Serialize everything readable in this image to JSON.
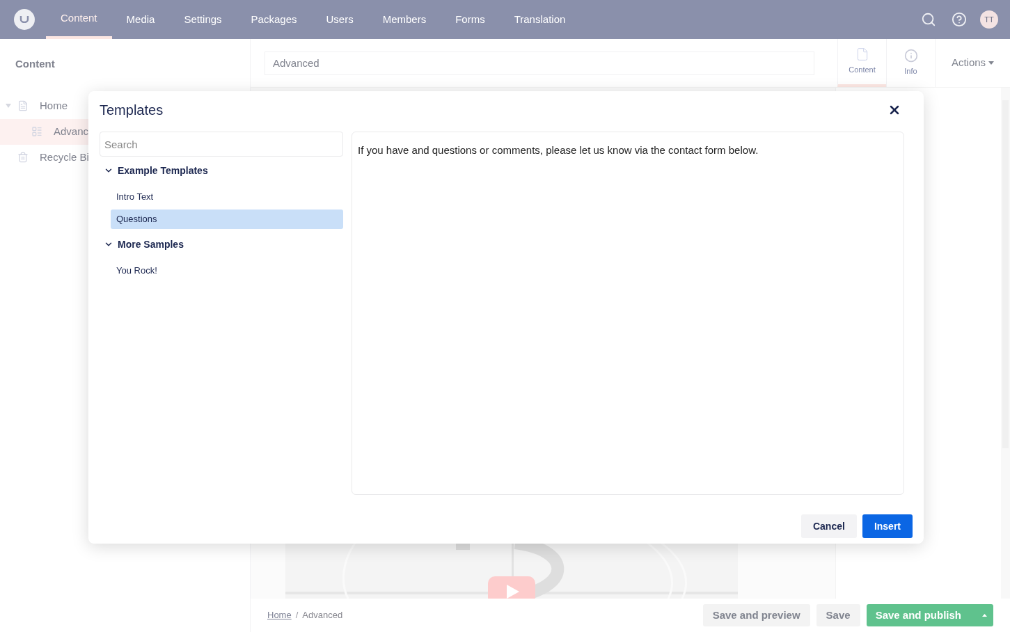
{
  "top_nav": {
    "tabs": [
      {
        "label": "Content",
        "selected": true
      },
      {
        "label": "Media",
        "selected": false
      },
      {
        "label": "Settings",
        "selected": false
      },
      {
        "label": "Packages",
        "selected": false
      },
      {
        "label": "Users",
        "selected": false
      },
      {
        "label": "Members",
        "selected": false
      },
      {
        "label": "Forms",
        "selected": false
      },
      {
        "label": "Translation",
        "selected": false
      }
    ],
    "avatar": "TT"
  },
  "sidebar": {
    "title": "Content",
    "tree": [
      {
        "label": "Home",
        "kind": "page",
        "expanded": true,
        "selected": false,
        "children": [
          {
            "label": "Advanc",
            "kind": "form",
            "selected": true
          }
        ]
      },
      {
        "label": "Recycle Bi",
        "kind": "bin",
        "selected": false
      }
    ]
  },
  "editor": {
    "name_value": "Advanced",
    "apps": [
      {
        "label": "Content",
        "kind": "document",
        "selected": true
      },
      {
        "label": "Info",
        "kind": "info",
        "selected": false
      }
    ],
    "actions": "Actions"
  },
  "footer": {
    "breadcrumb": [
      "Home",
      "Advanced"
    ],
    "breadcrumb_separator": "/",
    "buttons": [
      {
        "label": "Save and preview",
        "kind": "secondary"
      },
      {
        "label": "Save",
        "kind": "secondary"
      },
      {
        "label": "Save and publish",
        "kind": "primary"
      }
    ]
  },
  "dialog": {
    "title": "Templates",
    "search_placeholder": "Search",
    "groups": [
      {
        "label": "Example Templates",
        "expanded": true,
        "items": [
          {
            "label": "Intro Text",
            "selected": false
          },
          {
            "label": "Questions",
            "selected": true
          }
        ]
      },
      {
        "label": "More Samples",
        "expanded": true,
        "items": [
          {
            "label": "You Rock!",
            "selected": false
          }
        ]
      }
    ],
    "preview": "If you have and questions or comments, please let us know via the contact form below.",
    "buttons": [
      {
        "label": "Cancel",
        "kind": "secondary"
      },
      {
        "label": "Insert",
        "kind": "primary"
      }
    ]
  }
}
